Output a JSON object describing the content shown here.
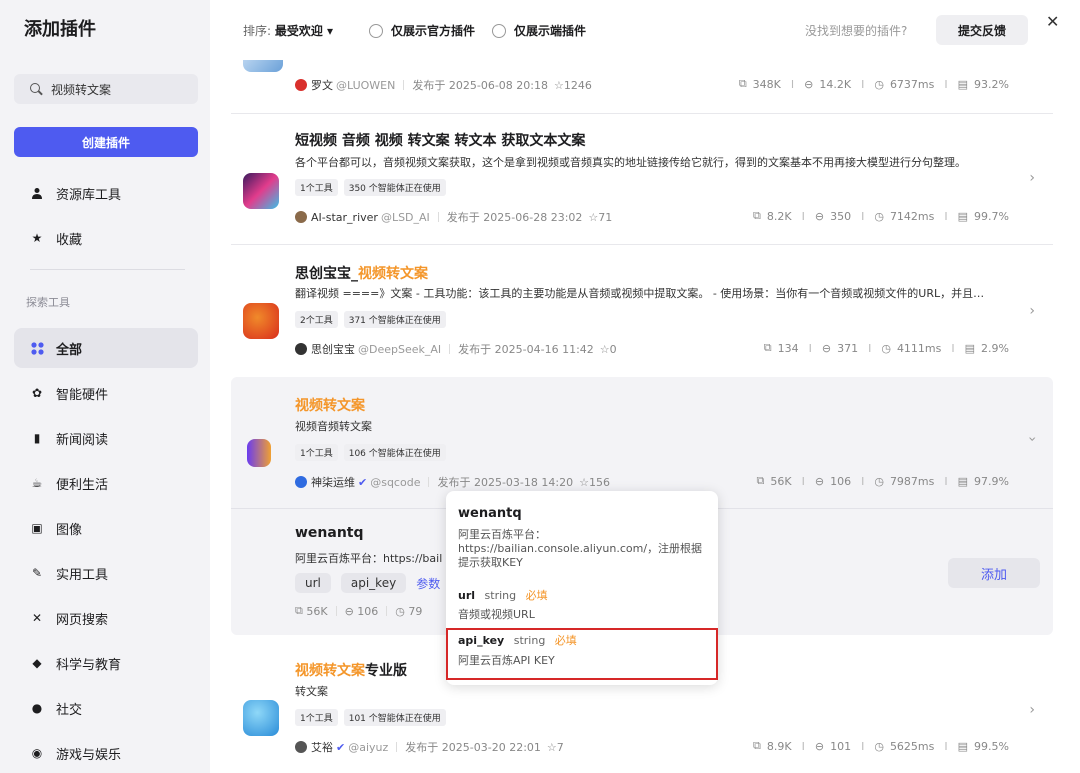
{
  "sidebar": {
    "title": "添加插件",
    "search_value": "视频转文案",
    "create_label": "创建插件",
    "top_items": [
      {
        "label": "资源库工具",
        "icon": "user-icon"
      },
      {
        "label": "收藏",
        "icon": "star-icon"
      }
    ],
    "section_label": "探索工具",
    "categories": [
      {
        "label": "全部",
        "icon": "grid-icon",
        "active": true
      },
      {
        "label": "智能硬件",
        "icon": "chip-icon"
      },
      {
        "label": "新闻阅读",
        "icon": "book-icon"
      },
      {
        "label": "便利生活",
        "icon": "cup-icon"
      },
      {
        "label": "图像",
        "icon": "image-icon"
      },
      {
        "label": "实用工具",
        "icon": "wrench-icon"
      },
      {
        "label": "网页搜索",
        "icon": "network-icon"
      },
      {
        "label": "科学与教育",
        "icon": "graduation-icon"
      },
      {
        "label": "社交",
        "icon": "chat-icon"
      },
      {
        "label": "游戏与娱乐",
        "icon": "gamepad-icon"
      }
    ]
  },
  "topbar": {
    "sort_prefix": "排序:",
    "sort_value": "最受欢迎 ▾",
    "filter_official": "仅展示官方插件",
    "filter_client": "仅展示端插件",
    "not_found": "没找到想要的插件?",
    "feedback": "提交反馈",
    "close": "✕"
  },
  "cards": [
    {
      "author": "罗文",
      "handle": "@LUOWEN",
      "published": "发布于 2025-06-08 20:18",
      "stars": "1246",
      "stats": [
        "348K",
        "14.2K",
        "6737ms",
        "93.2%"
      ]
    },
    {
      "title": "短视频 音频 视频 转文案 转文本 获取文本文案",
      "desc": "各个平台都可以，音频视频文案获取，这个是拿到视频或音频真实的地址链接传给它就行，得到的文案基本不用再接大模型进行分句整理。",
      "tags": [
        "1个工具",
        "350 个智能体正在使用"
      ],
      "author": "AI-star_river",
      "handle": "@LSD_AI",
      "published": "发布于 2025-06-28 23:02",
      "stars": "71",
      "stats": [
        "8.2K",
        "350",
        "7142ms",
        "99.7%"
      ]
    },
    {
      "title_plain": "思创宝宝_",
      "title_hl": "视频转文案",
      "desc": "翻译视频 ====》文案 - 工具功能：该工具的主要功能是从音频或视频中提取文案。 - 使用场景：当你有一个音频或视频文件的URL，并且…",
      "tags": [
        "2个工具",
        "371 个智能体正在使用"
      ],
      "author": "思创宝宝",
      "handle": "@DeepSeek_AI",
      "published": "发布于 2025-04-16 11:42",
      "stars": "0",
      "stats": [
        "134",
        "371",
        "4111ms",
        "2.9%"
      ]
    },
    {
      "title_hl": "视频转文案",
      "desc": "视频音频转文案",
      "tags": [
        "1个工具",
        "106 个智能体正在使用"
      ],
      "author": "神柒运维",
      "handle": "@sqcode",
      "published": "发布于 2025-03-18 14:20",
      "stars": "156",
      "stats": [
        "56K",
        "106",
        "7987ms",
        "97.9%"
      ]
    },
    {
      "title_hl": "视频转文案",
      "title_plain": "专业版",
      "desc": "转文案",
      "tags": [
        "1个工具",
        "101 个智能体正在使用"
      ],
      "author": "艾裕",
      "handle": "@aiyuz",
      "published": "发布于 2025-03-20 22:01",
      "stars": "7",
      "stats": [
        "8.9K",
        "101",
        "5625ms",
        "99.5%"
      ]
    }
  ],
  "tool": {
    "name": "wenantq",
    "desc": "阿里云百炼平台：https://bail",
    "params": [
      "url",
      "api_key"
    ],
    "params_link": "参数",
    "stats": [
      "56K",
      "106",
      "79"
    ],
    "add": "添加"
  },
  "tooltip": {
    "title": "wenantq",
    "desc": "阿里云百炼平台：https://bailian.console.aliyun.com/，注册根据提示获取KEY",
    "params": [
      {
        "name": "url",
        "type": "string",
        "required": "必填",
        "desc": "音频或视频URL"
      },
      {
        "name": "api_key",
        "type": "string",
        "required": "必填",
        "desc": "阿里云百炼API KEY"
      }
    ]
  },
  "colors": {
    "accent": "#4e5bf0",
    "highlight": "#f4962a",
    "annotation": "#d62828"
  }
}
